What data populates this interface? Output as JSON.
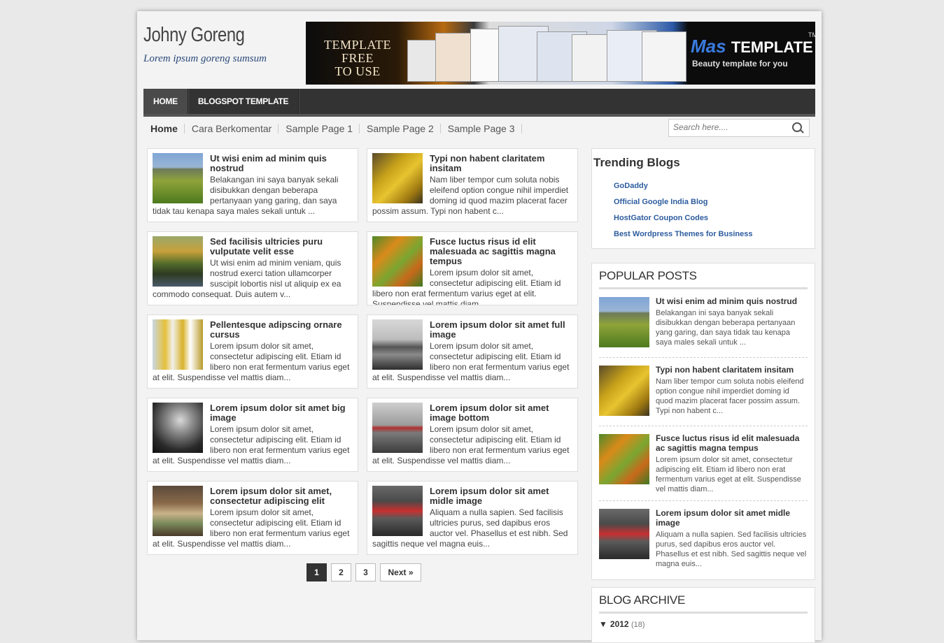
{
  "header": {
    "site_title": "Johny Goreng",
    "site_description": "Lorem ipsum goreng sumsum",
    "banner": {
      "left_text_line1": "TEMPLATE FREE",
      "left_text_line2": "TO USE",
      "brand_script": "Mas",
      "brand_bold": "TEMPLATE",
      "trademark": "TM",
      "tagline": "Beauty template for you"
    }
  },
  "top_menu": [
    "HOME",
    "BLOGSPOT TEMPLATE"
  ],
  "page_menu": [
    "Home",
    "Cara Berkomentar",
    "Sample Page 1",
    "Sample Page 2",
    "Sample Page 3"
  ],
  "search": {
    "placeholder": "Search here...."
  },
  "posts": [
    {
      "title": "Ut wisi enim ad minim quis nostrud",
      "excerpt": "Belakangan ini saya banyak sekali disibukkan dengan beberapa pertanyaan yang garing, dan saya tidak tau kenapa saya males sekali untuk ..."
    },
    {
      "title": "Typi non habent claritatem insitam",
      "excerpt": "Nam liber tempor cum soluta nobis eleifend option congue nihil imperdiet doming id quod mazim placerat facer possim assum. Typi non habent c..."
    },
    {
      "title": "Sed facilisis ultricies puru vulputate velit esse",
      "excerpt": "Ut wisi enim ad minim veniam, quis nostrud exerci tation ullamcorper suscipit lobortis nisl ut aliquip ex ea commodo consequat. Duis autem v..."
    },
    {
      "title": "Fusce luctus risus id elit malesuada ac sagittis magna tempus",
      "excerpt": "Lorem ipsum dolor sit amet, consectetur adipiscing elit. Etiam id libero non erat fermentum varius eget at elit. Suspendisse vel mattis diam..."
    },
    {
      "title": "Pellentesque adipscing ornare cursus",
      "excerpt": "Lorem ipsum dolor sit amet, consectetur adipiscing elit. Etiam id libero non erat fermentum varius eget at elit. Suspendisse vel mattis diam..."
    },
    {
      "title": "Lorem ipsum dolor sit amet full image",
      "excerpt": "Lorem ipsum dolor sit amet, consectetur adipiscing elit. Etiam id libero non erat fermentum varius eget at elit. Suspendisse vel mattis diam..."
    },
    {
      "title": "Lorem ipsum dolor sit amet big image",
      "excerpt": "Lorem ipsum dolor sit amet, consectetur adipiscing elit. Etiam id libero non erat fermentum varius eget at elit. Suspendisse vel mattis diam..."
    },
    {
      "title": "Lorem ipsum dolor sit amet image bottom",
      "excerpt": "Lorem ipsum dolor sit amet, consectetur adipiscing elit. Etiam id libero non erat fermentum varius eget at elit. Suspendisse vel mattis diam..."
    },
    {
      "title": "Lorem ipsum dolor sit amet, consectetur adipiscing elit",
      "excerpt": "Lorem ipsum dolor sit amet, consectetur adipiscing elit. Etiam id libero non erat fermentum varius eget at elit. Suspendisse vel mattis diam..."
    },
    {
      "title": "Lorem ipsum dolor sit amet midle image",
      "excerpt": "Aliquam a nulla sapien. Sed facilisis ultricies purus, sed dapibus eros auctor vel. Phasellus et est nibh. Sed sagittis neque vel magna euis..."
    }
  ],
  "pagination": {
    "pages": [
      "1",
      "2",
      "3"
    ],
    "next": "Next »",
    "current": "1"
  },
  "trending": {
    "title": "Trending Blogs",
    "links": [
      "GoDaddy",
      "Official Google India Blog",
      "HostGator Coupon Codes",
      "Best Wordpress Themes for Business"
    ]
  },
  "popular": {
    "title": "POPULAR POSTS",
    "items": [
      {
        "title": "Ut wisi enim ad minim quis nostrud",
        "excerpt": "Belakangan ini saya banyak sekali disibukkan dengan beberapa pertanyaan yang garing, dan saya tidak tau kenapa saya males sekali untuk ..."
      },
      {
        "title": "Typi non habent claritatem insitam",
        "excerpt": "Nam liber tempor cum soluta nobis eleifend option congue nihil imperdiet doming id quod mazim placerat facer possim assum. Typi non habent c..."
      },
      {
        "title": "Fusce luctus risus id elit malesuada ac sagittis magna tempus",
        "excerpt": "Lorem ipsum dolor sit amet, consectetur adipiscing elit. Etiam id libero non erat fermentum varius eget at elit. Suspendisse vel mattis diam..."
      },
      {
        "title": "Lorem ipsum dolor sit amet midle image",
        "excerpt": "Aliquam a nulla sapien. Sed facilisis ultricies purus, sed dapibus eros auctor vel. Phasellus et est nibh. Sed sagittis neque vel magna euis..."
      }
    ]
  },
  "archive": {
    "title": "BLOG ARCHIVE",
    "toggle": "▼",
    "year": "2012",
    "count": "(18)"
  },
  "colors": {
    "menu_bg": "#333333",
    "link": "#2d5c9e",
    "page_bg": "#f3f3f3"
  }
}
